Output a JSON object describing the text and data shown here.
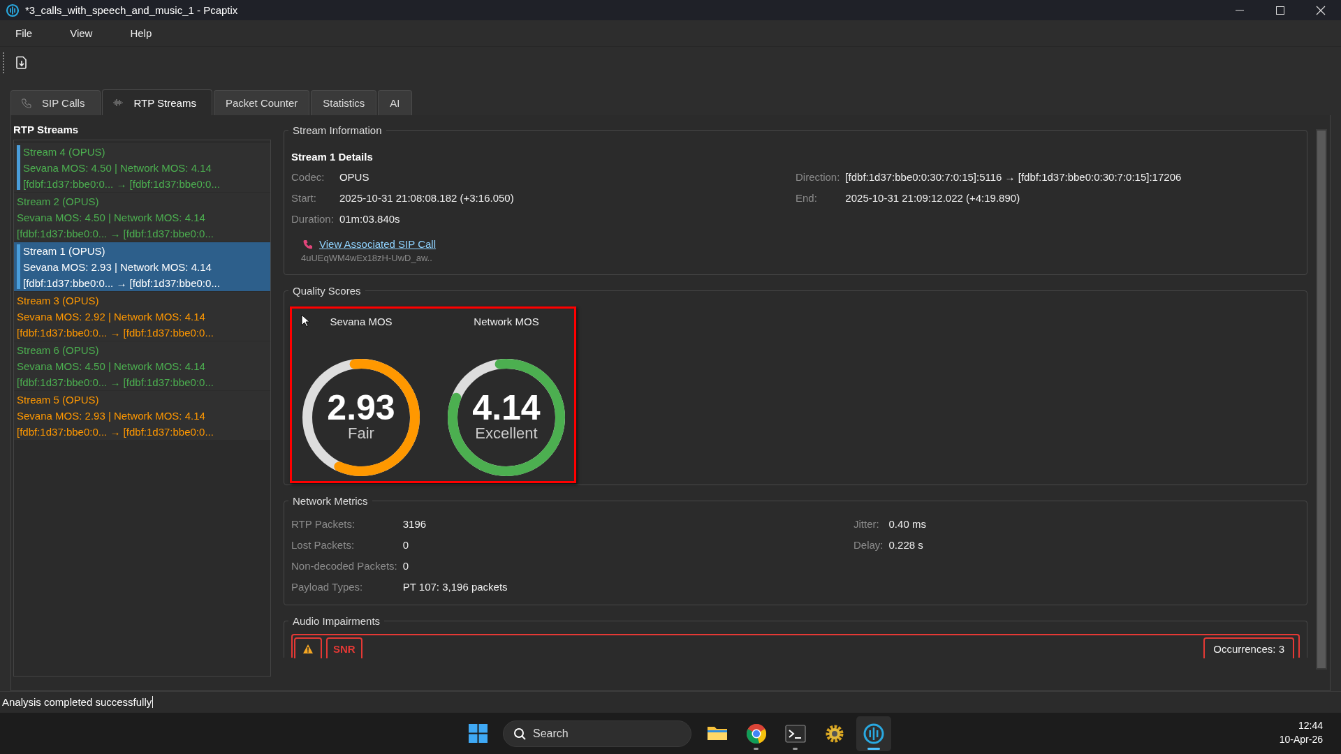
{
  "window": {
    "title": "*3_calls_with_speech_and_music_1 - Pcaptix"
  },
  "menu": [
    "File",
    "View",
    "Help"
  ],
  "tabs": [
    {
      "label": "SIP Calls",
      "kind": "phone",
      "selected": false
    },
    {
      "label": "RTP Streams",
      "kind": "wave",
      "selected": true
    },
    {
      "label": "Packet Counter",
      "kind": "none",
      "selected": false
    },
    {
      "label": "Statistics",
      "kind": "none",
      "selected": false
    },
    {
      "label": "AI",
      "kind": "none",
      "selected": false
    }
  ],
  "streams_panel": {
    "title": "RTP Streams",
    "streams": [
      {
        "name": "Stream 4 (OPUS)",
        "scores": "Sevana MOS: 4.50 | Network MOS: 4.14",
        "route": "[fdbf:1d37:bbe0:0... → [fdbf:1d37:bbe0:0...",
        "color": "#4caf50",
        "marked": true,
        "selected": false
      },
      {
        "name": "Stream 2 (OPUS)",
        "scores": "Sevana MOS: 4.50 | Network MOS: 4.14",
        "route": "[fdbf:1d37:bbe0:0... → [fdbf:1d37:bbe0:0...",
        "color": "#4caf50",
        "marked": false,
        "selected": false
      },
      {
        "name": "Stream 1 (OPUS)",
        "scores": "Sevana MOS: 2.93 | Network MOS: 4.14",
        "route": "[fdbf:1d37:bbe0:0... → [fdbf:1d37:bbe0:0...",
        "marked": true,
        "selected": true
      },
      {
        "name": "Stream 3 (OPUS)",
        "scores": "Sevana MOS: 2.92 | Network MOS: 4.14",
        "route": "[fdbf:1d37:bbe0:0... → [fdbf:1d37:bbe0:0...",
        "color": "#ff9800",
        "marked": false,
        "selected": false
      },
      {
        "name": "Stream 6 (OPUS)",
        "scores": "Sevana MOS: 4.50 | Network MOS: 4.14",
        "route": "[fdbf:1d37:bbe0:0... → [fdbf:1d37:bbe0:0...",
        "color": "#4caf50",
        "marked": false,
        "selected": false
      },
      {
        "name": "Stream 5 (OPUS)",
        "scores": "Sevana MOS: 2.93 | Network MOS: 4.14",
        "route": "[fdbf:1d37:bbe0:0... → [fdbf:1d37:bbe0:0...",
        "color": "#ff9800",
        "marked": false,
        "selected": false
      }
    ]
  },
  "stream_information": {
    "title": "Stream Information",
    "heading": "Stream 1 Details",
    "fields_left": [
      {
        "label": "Codec:",
        "value": "OPUS"
      },
      {
        "label": "Start:",
        "value": "2025-10-31 21:08:08.182 (+3:16.050)"
      },
      {
        "label": "Duration:",
        "value": "01m:03.840s"
      }
    ],
    "fields_right": [
      {
        "label": "Direction:",
        "value": "[fdbf:1d37:bbe0:0:30:7:0:15]:5116 → [fdbf:1d37:bbe0:0:30:7:0:15]:17206"
      },
      {
        "label": "End:",
        "value": "2025-10-31 21:09:12.022 (+4:19.890)"
      }
    ],
    "link": "View Associated SIP Call",
    "call_id": "4uUEqWM4wEx18zH-UwD_aw.."
  },
  "quality_scores": {
    "title": "Quality Scores",
    "gauges": [
      {
        "title": "Sevana MOS",
        "value": "2.93",
        "rating": "Fair",
        "level": 0.586,
        "color": "#ff9800"
      },
      {
        "title": "Network MOS",
        "value": "4.14",
        "rating": "Excellent",
        "level": 0.828,
        "color": "#4caf50"
      }
    ]
  },
  "network_metrics": {
    "title": "Network Metrics",
    "fields_left": [
      {
        "label": "RTP Packets:",
        "value": "3196"
      },
      {
        "label": "Lost Packets:",
        "value": "0"
      },
      {
        "label": "Non-decoded Packets:",
        "value": "0"
      },
      {
        "label": "Payload Types:",
        "value": "PT 107: 3,196 packets"
      }
    ],
    "fields_right": [
      {
        "label": "Jitter:",
        "value": "0.40 ms"
      },
      {
        "label": "Delay:",
        "value": "0.228 s"
      }
    ]
  },
  "audio_impairments": {
    "title": "Audio Impairments",
    "items": [
      {
        "name": "SNR",
        "occurrences": "Occurrences: 3"
      }
    ]
  },
  "status_bar": {
    "text": "Analysis completed successfully"
  },
  "taskbar": {
    "search_placeholder": "Search",
    "time": "12:44",
    "date": "10-Apr-26",
    "apps": [
      {
        "kind": "folder",
        "running": false,
        "active": false
      },
      {
        "kind": "browser",
        "running": true,
        "active": false
      },
      {
        "kind": "terminal",
        "running": true,
        "active": false
      },
      {
        "kind": "gear",
        "running": false,
        "active": false
      },
      {
        "kind": "app",
        "running": true,
        "active": true
      }
    ]
  }
}
